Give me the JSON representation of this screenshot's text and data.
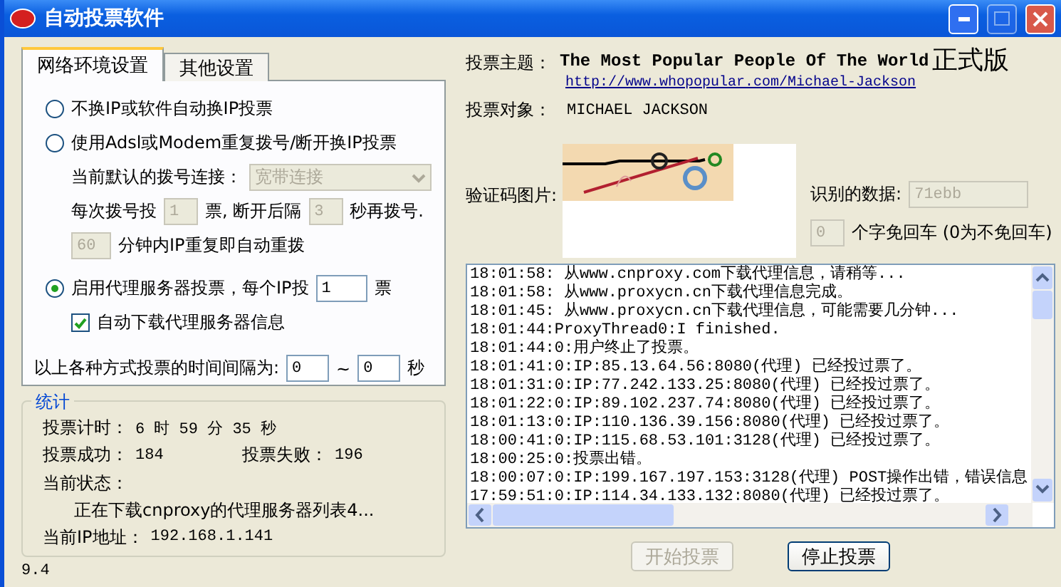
{
  "window": {
    "title": "自动投票软件"
  },
  "tabs": [
    {
      "label": "网络环境设置",
      "selected": true
    },
    {
      "label": "其他设置",
      "selected": false
    }
  ],
  "modes": [
    {
      "kind": "plain",
      "label": "不换IP或软件自动换IP投票",
      "selected": false
    },
    {
      "kind": "dialup",
      "label": "使用Adsl或Modem重复拨号/断开换IP投票",
      "selected": false,
      "disabled": true,
      "connection_label": "当前默认的拨号连接：",
      "connection_value": "宽带连接",
      "votes_label": "每次拨号投",
      "votes_value": "1",
      "votes_unit": "票, 断开后隔",
      "wait_value": "3",
      "wait_unit": "秒再拨号.",
      "repeat_value": "60",
      "repeat_label": "分钟内IP重复即自动重拨"
    },
    {
      "kind": "proxy",
      "label": "启用代理服务器投票，每个IP投",
      "selected": true,
      "votes_value": "1",
      "votes_unit": "票",
      "auto_download": {
        "label": "自动下载代理服务器信息",
        "checked": true
      }
    }
  ],
  "interval": {
    "label": "以上各种方式投票的时间间隔为:",
    "min": "0",
    "separator": "~",
    "max": "0",
    "unit": "秒"
  },
  "stats": {
    "title": "统计",
    "timer_label": "投票计时：",
    "timer_value": "6 时 59 分 35 秒",
    "success_label": "投票成功：",
    "success_value": "184",
    "fail_label": "投票失败：",
    "fail_value": "196",
    "status_label": "当前状态：",
    "status_value": "正在下载cnproxy的代理服务器列表4...",
    "ip_label": "当前IP地址：",
    "ip_value": "192.168.1.141"
  },
  "version": "9.4",
  "edition": "正式版",
  "vote": {
    "topic_label": "投票主题：",
    "topic": "The Most Popular People Of The World",
    "url": "http://www.whopopular.com/Michael-Jackson",
    "target_label": "投票对象：",
    "target": "MICHAEL JACKSON"
  },
  "captcha": {
    "label": "验证码图片:",
    "recognized_label": "识别的数据:",
    "recognized_value": "71ebb",
    "chars_value": "0",
    "chars_label": "个字免回车 (0为不免回车)"
  },
  "log": [
    "18:01:58: 从www.cnproxy.com下载代理信息，请稍等...",
    "18:01:58: 从www.proxycn.cn下载代理信息完成。",
    "18:01:45: 从www.proxycn.cn下载代理信息，可能需要几分钟...",
    "18:01:44:ProxyThread0:I finished.",
    "18:01:44:0:用户终止了投票。",
    "18:01:41:0:IP:85.13.64.56:8080(代理) 已经投过票了。",
    "18:01:31:0:IP:77.242.133.25:8080(代理) 已经投过票了。",
    "18:01:22:0:IP:89.102.237.74:8080(代理) 已经投过票了。",
    "18:01:13:0:IP:110.136.39.156:8080(代理) 已经投过票了。",
    "18:00:41:0:IP:115.68.53.101:3128(代理) 已经投过票了。",
    "18:00:25:0:投票出错。",
    "18:00:07:0:IP:199.167.197.153:3128(代理) POST操作出错，错误信息",
    "17:59:51:0:IP:114.34.133.132:8080(代理) 已经投过票了。"
  ],
  "buttons": [
    {
      "label": "开始投票",
      "disabled": true
    },
    {
      "label": "停止投票",
      "disabled": false
    }
  ]
}
